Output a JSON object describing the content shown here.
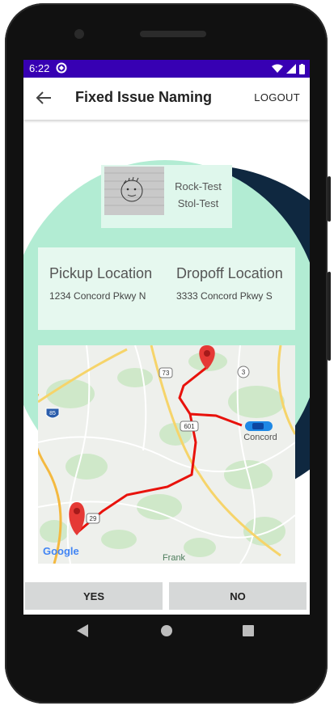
{
  "status_bar": {
    "time": "6:22"
  },
  "app_bar": {
    "title": "Fixed Issue Naming",
    "logout_label": "LOGOUT"
  },
  "profile": {
    "name1": "Rock-Test",
    "name2": "Stol-Test"
  },
  "locations": {
    "pickup_heading": "Pickup Location",
    "pickup_address": "1234 Concord Pkwy N",
    "dropoff_heading": "Dropoff Location",
    "dropoff_address": "3333 Concord Pkwy S"
  },
  "map": {
    "route_shields": [
      "73",
      "3",
      "601",
      "29",
      "85"
    ],
    "place_labels": [
      "Concord",
      "Frank"
    ],
    "attribution": "Google"
  },
  "actions": {
    "yes_label": "YES",
    "no_label": "NO"
  },
  "colors": {
    "status_bar": "#3700b3",
    "mint": "#b2ecd3",
    "navy": "#0f2840",
    "route": "#e8120c",
    "pin": "#e53935"
  }
}
